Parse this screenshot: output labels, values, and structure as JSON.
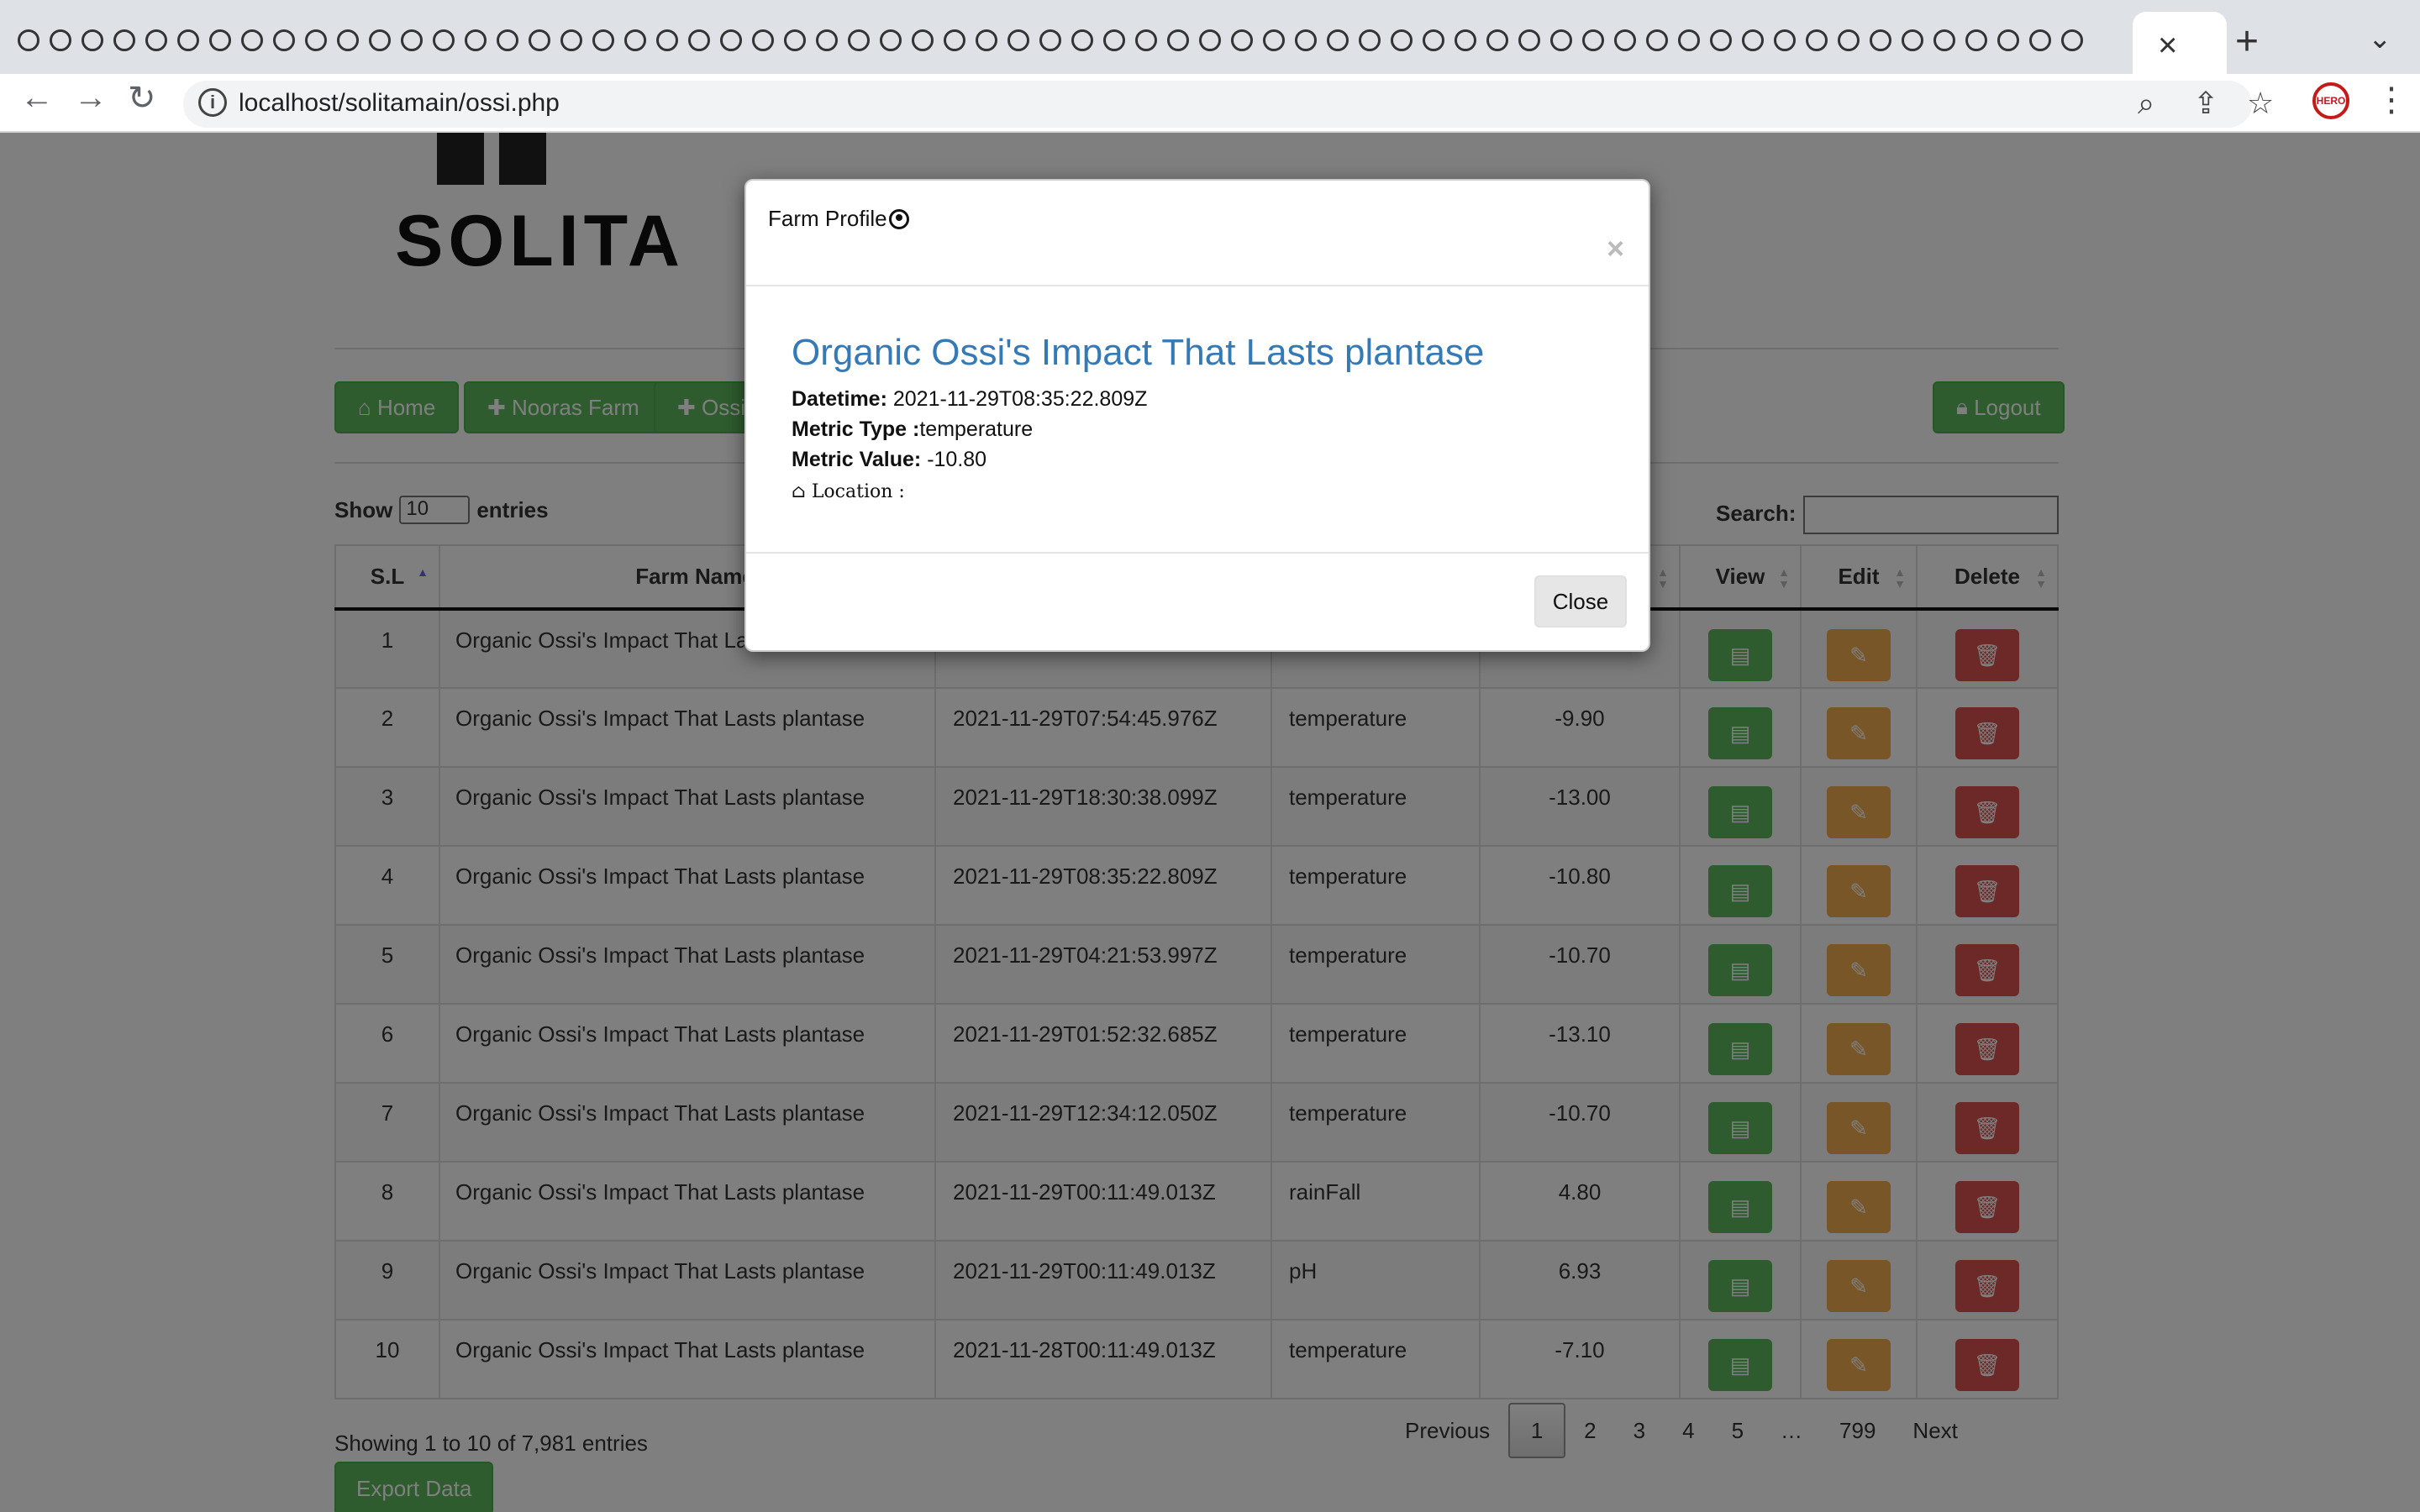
{
  "browser": {
    "url": "localhost/solitamain/ossi.php",
    "active_tab_close": "×",
    "new_tab": "+"
  },
  "site": {
    "logo_text": "SOLITA",
    "nav": {
      "home": "Home",
      "nooras": "Nooras Farm",
      "ossi": "Ossi...",
      "logout": "Logout"
    }
  },
  "table_controls": {
    "show_label": "Show",
    "entries_value": "10",
    "entries_label": "entries",
    "search_label": "Search:"
  },
  "table": {
    "headers": {
      "sl": "S.L",
      "farm_name": "Farm Name",
      "view": "View",
      "edit": "Edit",
      "delete": "Delete"
    },
    "rows": [
      {
        "sl": "1",
        "farm": "Organic Ossi's Impact That La",
        "datetime": "",
        "metric_type": "",
        "metric_value": ""
      },
      {
        "sl": "2",
        "farm": "Organic Ossi's Impact That Lasts plantase",
        "datetime": "2021-11-29T07:54:45.976Z",
        "metric_type": "temperature",
        "metric_value": "-9.90"
      },
      {
        "sl": "3",
        "farm": "Organic Ossi's Impact That Lasts plantase",
        "datetime": "2021-11-29T18:30:38.099Z",
        "metric_type": "temperature",
        "metric_value": "-13.00"
      },
      {
        "sl": "4",
        "farm": "Organic Ossi's Impact That Lasts plantase",
        "datetime": "2021-11-29T08:35:22.809Z",
        "metric_type": "temperature",
        "metric_value": "-10.80"
      },
      {
        "sl": "5",
        "farm": "Organic Ossi's Impact That Lasts plantase",
        "datetime": "2021-11-29T04:21:53.997Z",
        "metric_type": "temperature",
        "metric_value": "-10.70"
      },
      {
        "sl": "6",
        "farm": "Organic Ossi's Impact That Lasts plantase",
        "datetime": "2021-11-29T01:52:32.685Z",
        "metric_type": "temperature",
        "metric_value": "-13.10"
      },
      {
        "sl": "7",
        "farm": "Organic Ossi's Impact That Lasts plantase",
        "datetime": "2021-11-29T12:34:12.050Z",
        "metric_type": "temperature",
        "metric_value": "-10.70"
      },
      {
        "sl": "8",
        "farm": "Organic Ossi's Impact That Lasts plantase",
        "datetime": "2021-11-29T00:11:49.013Z",
        "metric_type": "rainFall",
        "metric_value": "4.80"
      },
      {
        "sl": "9",
        "farm": "Organic Ossi's Impact That Lasts plantase",
        "datetime": "2021-11-29T00:11:49.013Z",
        "metric_type": "pH",
        "metric_value": "6.93"
      },
      {
        "sl": "10",
        "farm": "Organic Ossi's Impact That Lasts plantase",
        "datetime": "2021-11-28T00:11:49.013Z",
        "metric_type": "temperature",
        "metric_value": "-7.10"
      }
    ]
  },
  "footer": {
    "info": "Showing 1 to 10 of 7,981 entries",
    "pagination": {
      "previous": "Previous",
      "pages": [
        "1",
        "2",
        "3",
        "4",
        "5",
        "…",
        "799"
      ],
      "active": "1",
      "next": "Next"
    },
    "export": "Export Data"
  },
  "modal": {
    "title": "Farm Profile",
    "close_x": "×",
    "farm_title": "Organic Ossi's Impact That Lasts plantase",
    "datetime_label": "Datetime:",
    "datetime_value": "2021-11-29T08:35:22.809Z",
    "metric_type_label": "Metric Type :",
    "metric_type_value": "temperature",
    "metric_value_label": "Metric Value:",
    "metric_value_value": "-10.80",
    "location_label": "Location :",
    "close_button": "Close"
  },
  "colors": {
    "success": "#5cb85c",
    "warning": "#f0ad4e",
    "danger": "#d9534f",
    "link": "#337ab7"
  }
}
